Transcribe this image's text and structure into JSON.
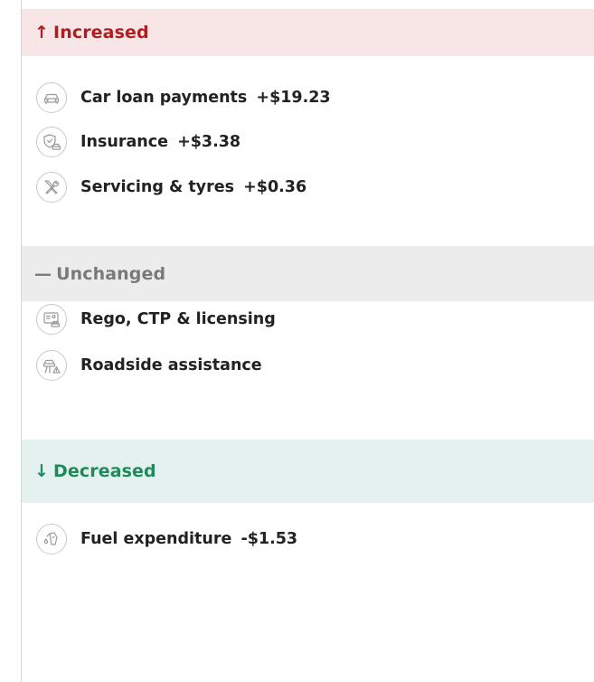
{
  "sections": {
    "increased": {
      "arrow": "↑",
      "title": "Increased",
      "color": "#b01e22",
      "background": "#f8e5e6",
      "items": [
        {
          "icon": "car-icon",
          "label": "Car loan payments",
          "delta": "+$19.23"
        },
        {
          "icon": "insurance-shield-icon",
          "label": "Insurance",
          "delta": "+$3.38"
        },
        {
          "icon": "tools-icon",
          "label": "Servicing & tyres",
          "delta": "+$0.36"
        }
      ]
    },
    "unchanged": {
      "arrow": "—",
      "title": "Unchanged",
      "color": "#7a7a7a",
      "background": "#ececec",
      "items": [
        {
          "icon": "licence-card-icon",
          "label": "Rego, CTP & licensing"
        },
        {
          "icon": "roadside-warning-icon",
          "label": "Roadside assistance"
        }
      ]
    },
    "decreased": {
      "arrow": "↓",
      "title": "Decreased",
      "color": "#1f8a5b",
      "background": "#e5f1ef",
      "items": [
        {
          "icon": "fuel-pump-icon",
          "label": "Fuel expenditure",
          "delta": "-$1.53"
        }
      ]
    }
  }
}
